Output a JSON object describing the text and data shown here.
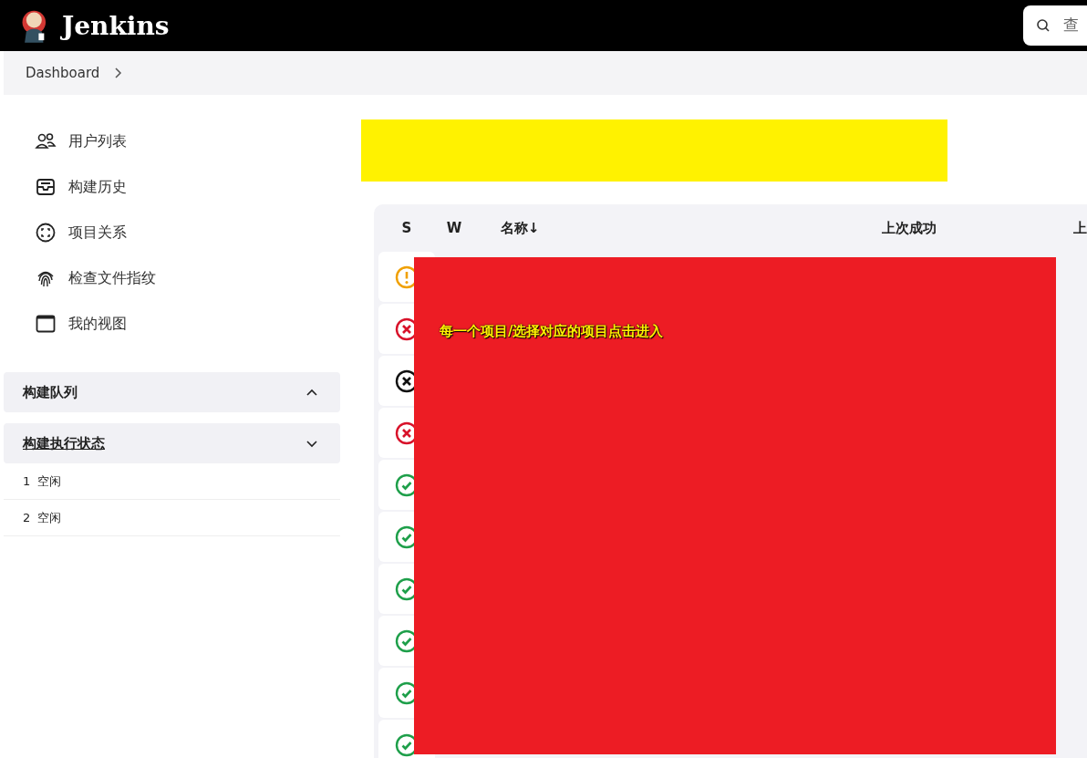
{
  "header": {
    "title": "Jenkins",
    "search": {
      "placeholder": "查"
    }
  },
  "breadcrumb": [
    {
      "label": "Dashboard"
    }
  ],
  "sidebar": {
    "items": [
      {
        "kind": "users",
        "label": "用户列表"
      },
      {
        "kind": "history",
        "label": "构建历史"
      },
      {
        "kind": "relation",
        "label": "项目关系"
      },
      {
        "kind": "fingerprint",
        "label": "检查文件指纹"
      },
      {
        "kind": "view",
        "label": "我的视图"
      }
    ]
  },
  "panels": [
    {
      "title": "构建队列",
      "expanded": true,
      "underlined": false
    },
    {
      "title": "构建执行状态",
      "expanded": false,
      "underlined": true,
      "items": [
        {
          "number": "1",
          "status": "空闲"
        },
        {
          "number": "2",
          "status": "空闲"
        }
      ]
    }
  ],
  "table": {
    "columns": [
      {
        "label": "S"
      },
      {
        "label": "W"
      },
      {
        "label": "名称",
        "sort": "↓"
      },
      {
        "label": "上次成功"
      },
      {
        "label": "上"
      }
    ],
    "rows": [
      {
        "kind": "warning"
      },
      {
        "kind": "failed"
      },
      {
        "kind": "aborted"
      },
      {
        "kind": "failed"
      },
      {
        "kind": "success"
      },
      {
        "kind": "success"
      },
      {
        "kind": "success"
      },
      {
        "kind": "success"
      },
      {
        "kind": "success"
      },
      {
        "kind": "success"
      }
    ]
  },
  "annotation": {
    "text": "每一个项目/选择对应的项目点击进入"
  }
}
